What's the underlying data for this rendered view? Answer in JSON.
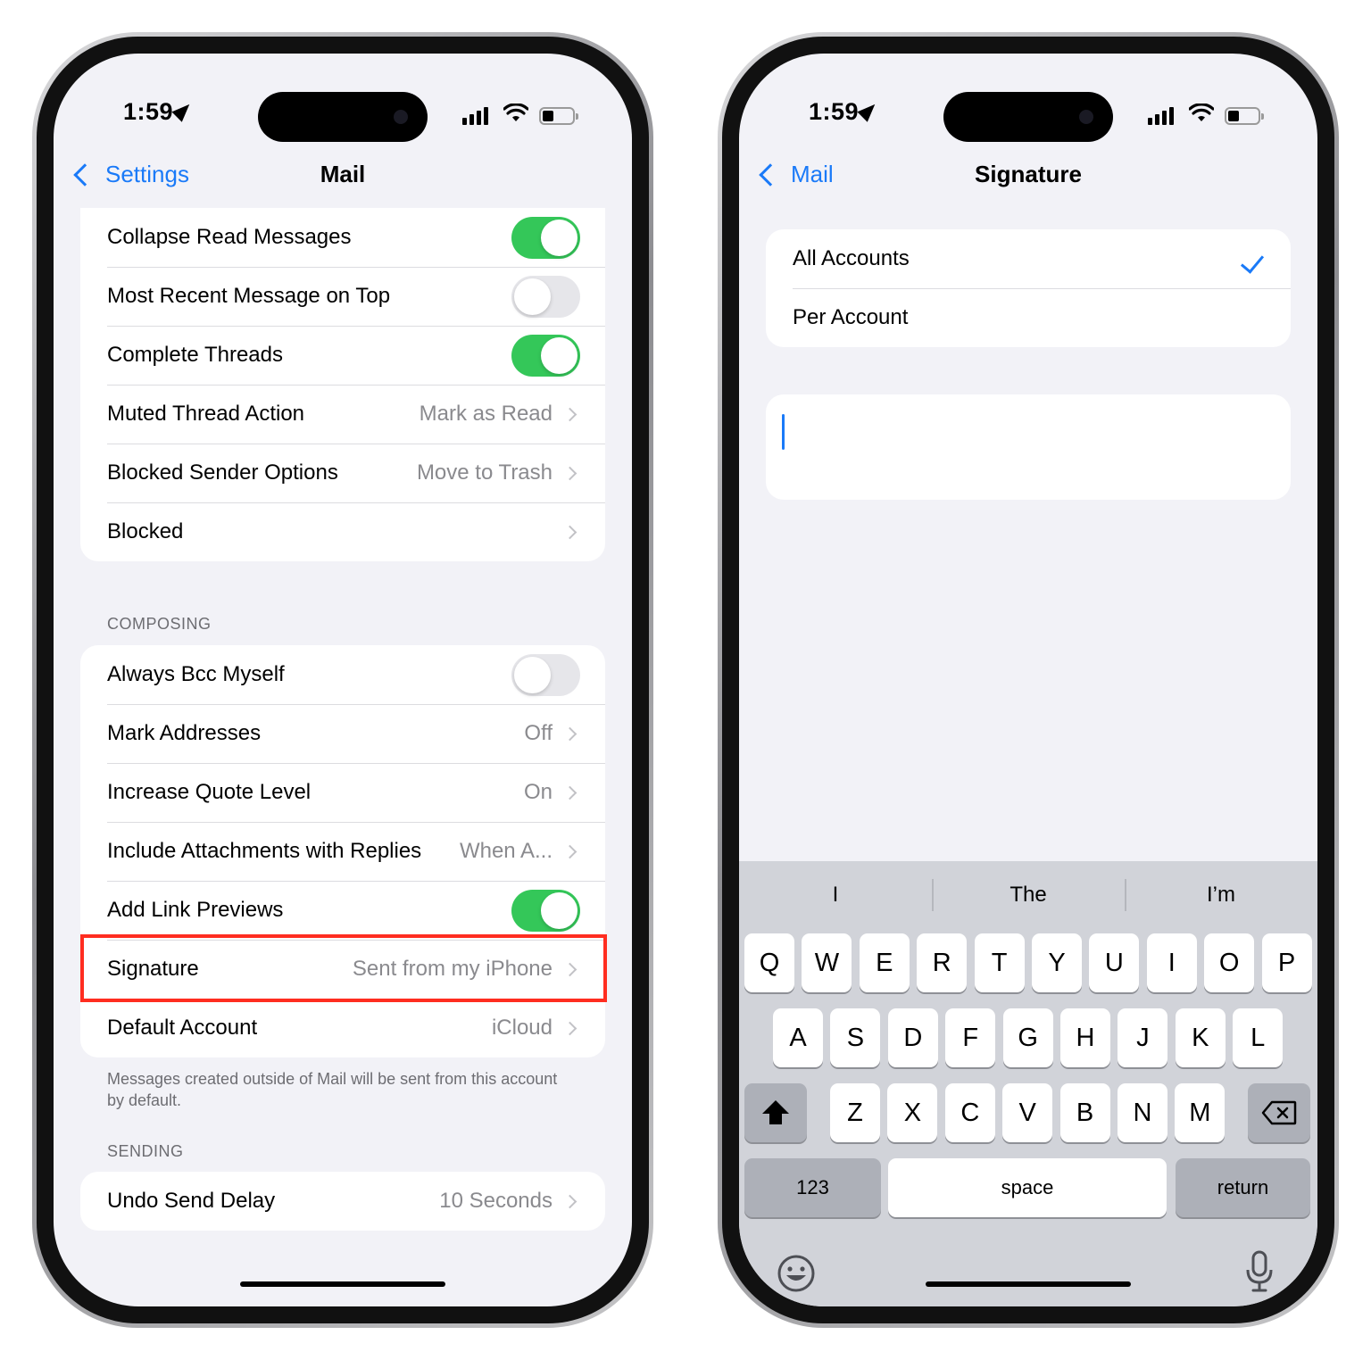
{
  "left_phone": {
    "status": {
      "time": "1:59"
    },
    "nav": {
      "back_label": "Settings",
      "title": "Mail"
    },
    "threading_rows": [
      {
        "label": "Collapse Read Messages",
        "toggle": true
      },
      {
        "label": "Most Recent Message on Top",
        "toggle": false
      },
      {
        "label": "Complete Threads",
        "toggle": true
      },
      {
        "label": "Muted Thread Action",
        "value": "Mark as Read"
      },
      {
        "label": "Blocked Sender Options",
        "value": "Move to Trash"
      },
      {
        "label": "Blocked",
        "value": ""
      }
    ],
    "composing": {
      "header": "COMPOSING",
      "rows": [
        {
          "label": "Always Bcc Myself",
          "toggle": false
        },
        {
          "label": "Mark Addresses",
          "value": "Off"
        },
        {
          "label": "Increase Quote Level",
          "value": "On"
        },
        {
          "label": "Include Attachments with Replies",
          "value": "When A..."
        },
        {
          "label": "Add Link Previews",
          "toggle": true
        },
        {
          "label": "Signature",
          "value": "Sent from my iPhone"
        },
        {
          "label": "Default Account",
          "value": "iCloud"
        }
      ],
      "footnote": "Messages created outside of Mail will be sent from this account by default."
    },
    "sending": {
      "header": "SENDING",
      "rows": [
        {
          "label": "Undo Send Delay",
          "value": "10 Seconds"
        }
      ]
    },
    "highlight_color": "#ff2d20",
    "toggle_on_color": "#34c759"
  },
  "right_phone": {
    "status": {
      "time": "1:59"
    },
    "nav": {
      "back_label": "Mail",
      "title": "Signature"
    },
    "options": [
      {
        "label": "All Accounts",
        "selected": true
      },
      {
        "label": "Per Account",
        "selected": false
      }
    ],
    "signature_text": "",
    "keyboard": {
      "suggestions": [
        "I",
        "The",
        "I’m"
      ],
      "row1": [
        "Q",
        "W",
        "E",
        "R",
        "T",
        "Y",
        "U",
        "I",
        "O",
        "P"
      ],
      "row2": [
        "A",
        "S",
        "D",
        "F",
        "G",
        "H",
        "J",
        "K",
        "L"
      ],
      "row3": [
        "Z",
        "X",
        "C",
        "V",
        "B",
        "N",
        "M"
      ],
      "numbers_label": "123",
      "space_label": "space",
      "return_label": "return"
    },
    "accent_color": "#1a7af8"
  }
}
